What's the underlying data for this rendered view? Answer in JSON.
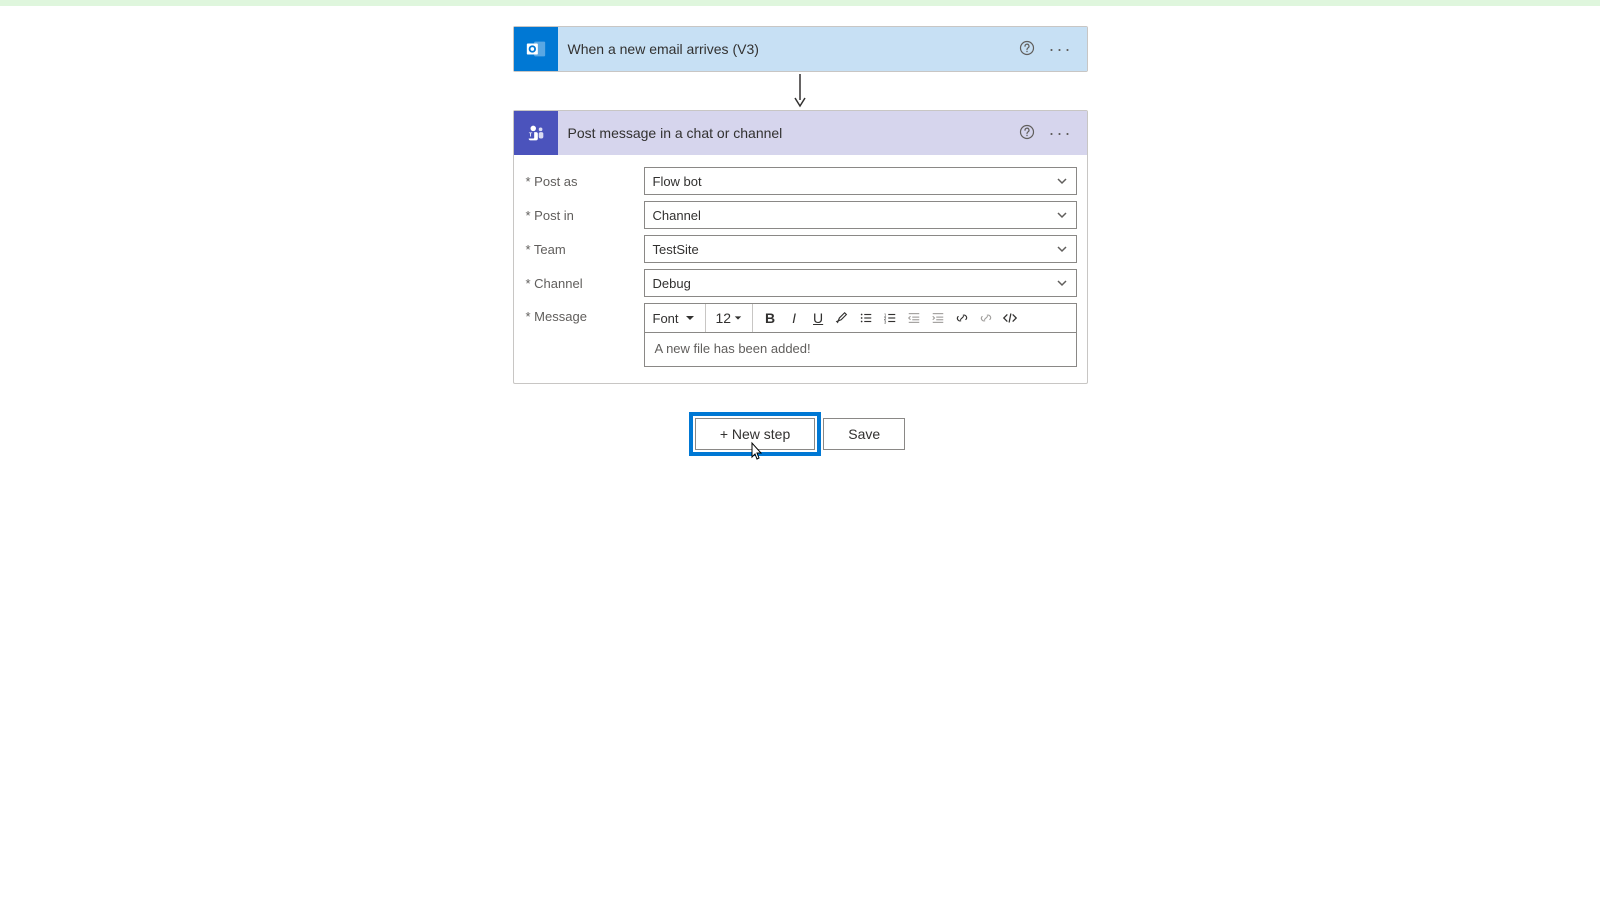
{
  "trigger": {
    "title": "When a new email arrives (V3)"
  },
  "action": {
    "title": "Post message in a chat or channel",
    "fields": {
      "post_as": {
        "label": "* Post as",
        "value": "Flow bot"
      },
      "post_in": {
        "label": "* Post in",
        "value": "Channel"
      },
      "team": {
        "label": "* Team",
        "value": "TestSite"
      },
      "channel": {
        "label": "* Channel",
        "value": "Debug"
      },
      "message": {
        "label": "* Message",
        "value": "A new file has been added!"
      }
    },
    "rte": {
      "font_label": "Font",
      "size_label": "12"
    }
  },
  "buttons": {
    "new_step": "+ New step",
    "save": "Save"
  }
}
